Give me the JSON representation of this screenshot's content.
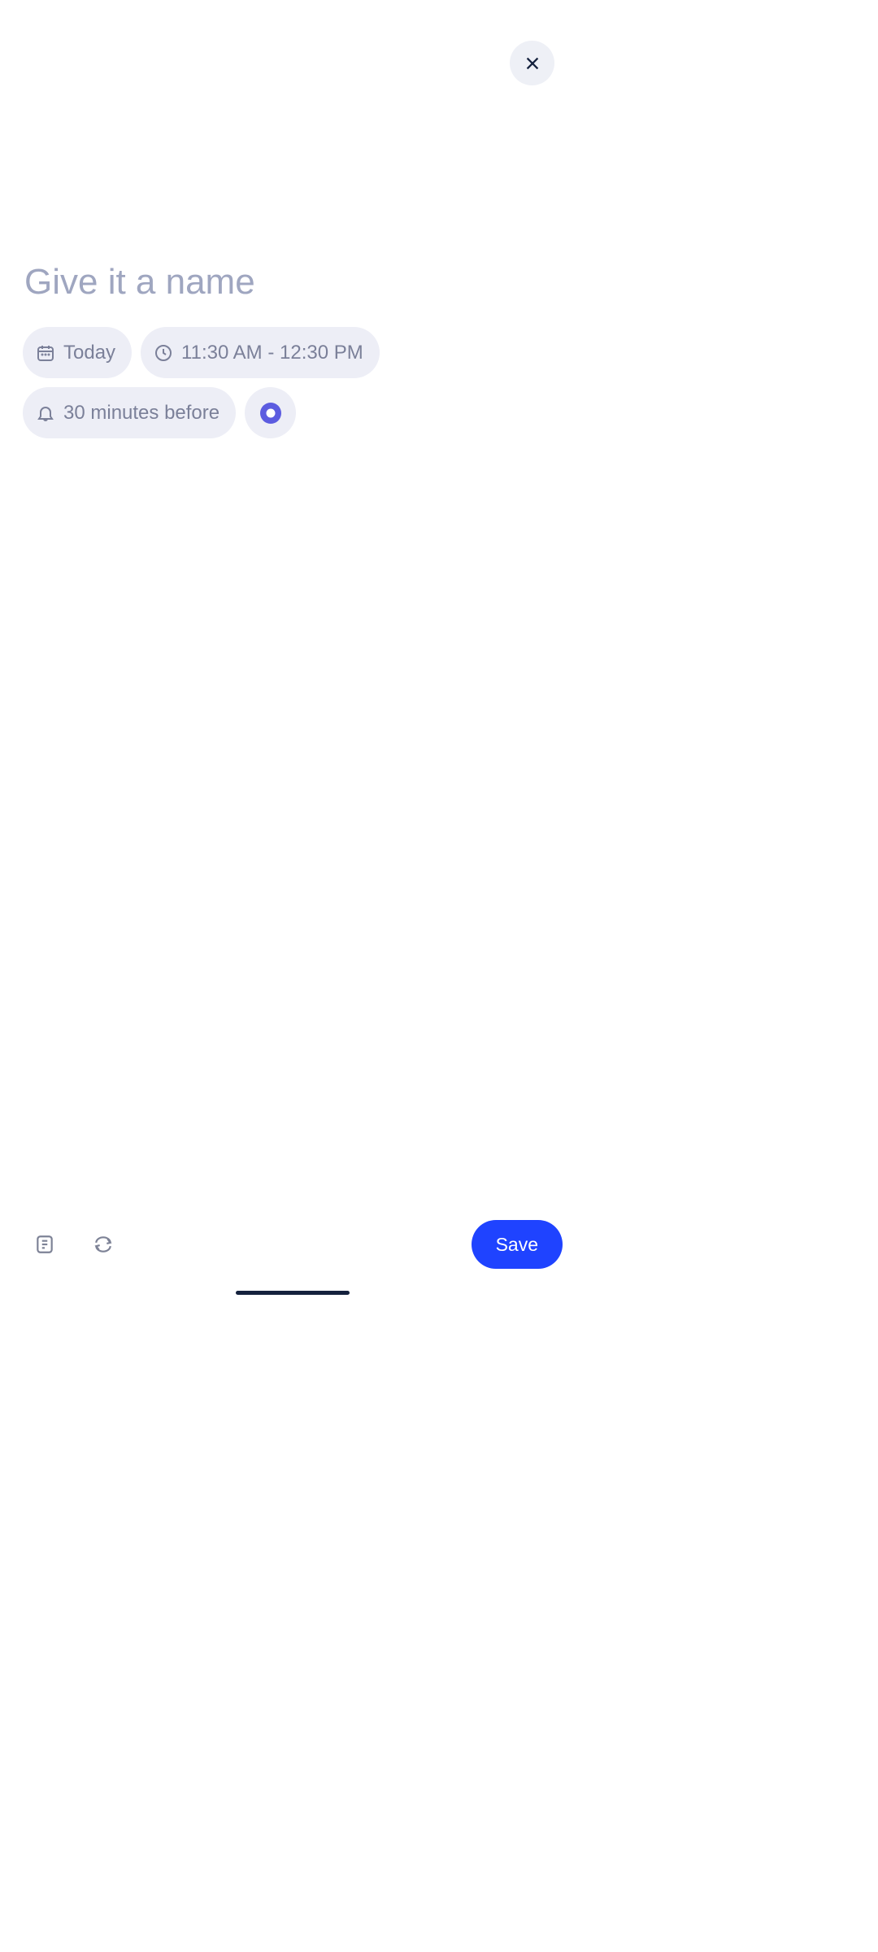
{
  "title": {
    "placeholder": "Give it a name",
    "value": ""
  },
  "chips": {
    "date": "Today",
    "time": "11:30 AM - 12:30 PM",
    "reminder": "30 minutes before",
    "color": "#5c5ce0"
  },
  "actions": {
    "save": "Save"
  }
}
